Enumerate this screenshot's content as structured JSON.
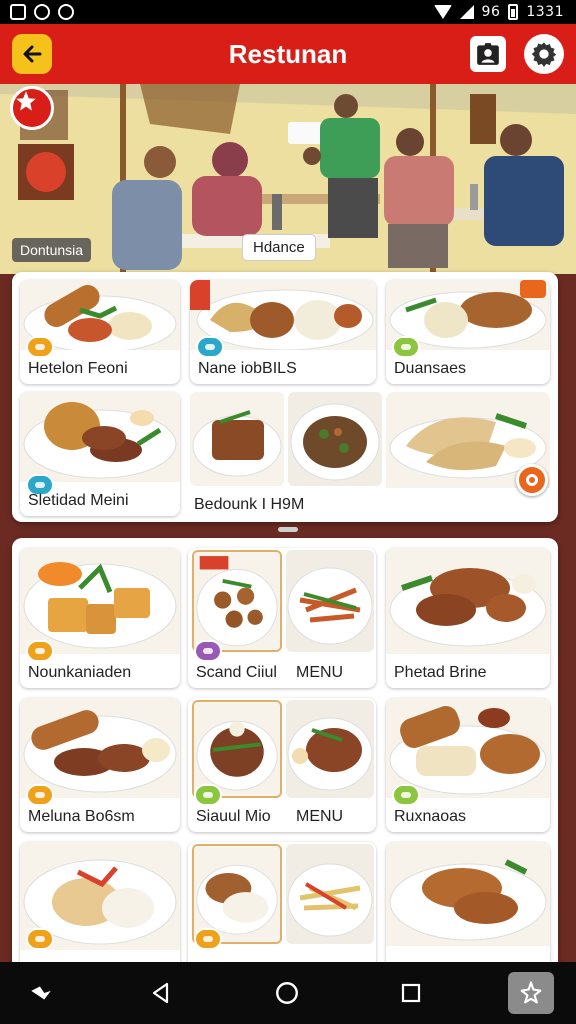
{
  "status_bar": {
    "time": "1331",
    "battery_text": "96"
  },
  "app_bar": {
    "title": "Restunan"
  },
  "hero": {
    "left_label": "Dontunsia",
    "center_label": "Hdance"
  },
  "top_grid": {
    "items": [
      {
        "label": "Hetelon Feoni",
        "badge_color": "#f0a11a"
      },
      {
        "label": "Nane iobBILS",
        "badge_color": "#2aa7c9"
      },
      {
        "label": "Duansaes",
        "badge_color": "#8cc63f"
      },
      {
        "label": "Sletidad Meini",
        "badge_color": "#2aa7c9"
      },
      {
        "label": "Bedounk I H9M",
        "badge_color": null
      },
      {
        "label": "",
        "badge_color": null
      }
    ]
  },
  "bottom_grid": {
    "items": [
      {
        "label": "Nounkaniaden",
        "badge_color": "#f0a11a"
      },
      {
        "label": "Scand Ciiul",
        "badge_color": "#9b59b6"
      },
      {
        "label": "MENU",
        "badge_color": null
      },
      {
        "label": "Phetad Brine",
        "badge_color": null
      },
      {
        "label": "Meluna Bo6sm",
        "badge_color": "#f0a11a"
      },
      {
        "label": "Siauul Mio",
        "badge_color": "#8cc63f"
      },
      {
        "label": "MENU",
        "badge_color": null
      },
      {
        "label": "Ruxnaoas",
        "badge_color": "#8cc63f"
      }
    ]
  },
  "colors": {
    "brand": "#d91e18",
    "accent": "#f4c21b",
    "fab": "#e8671c"
  }
}
